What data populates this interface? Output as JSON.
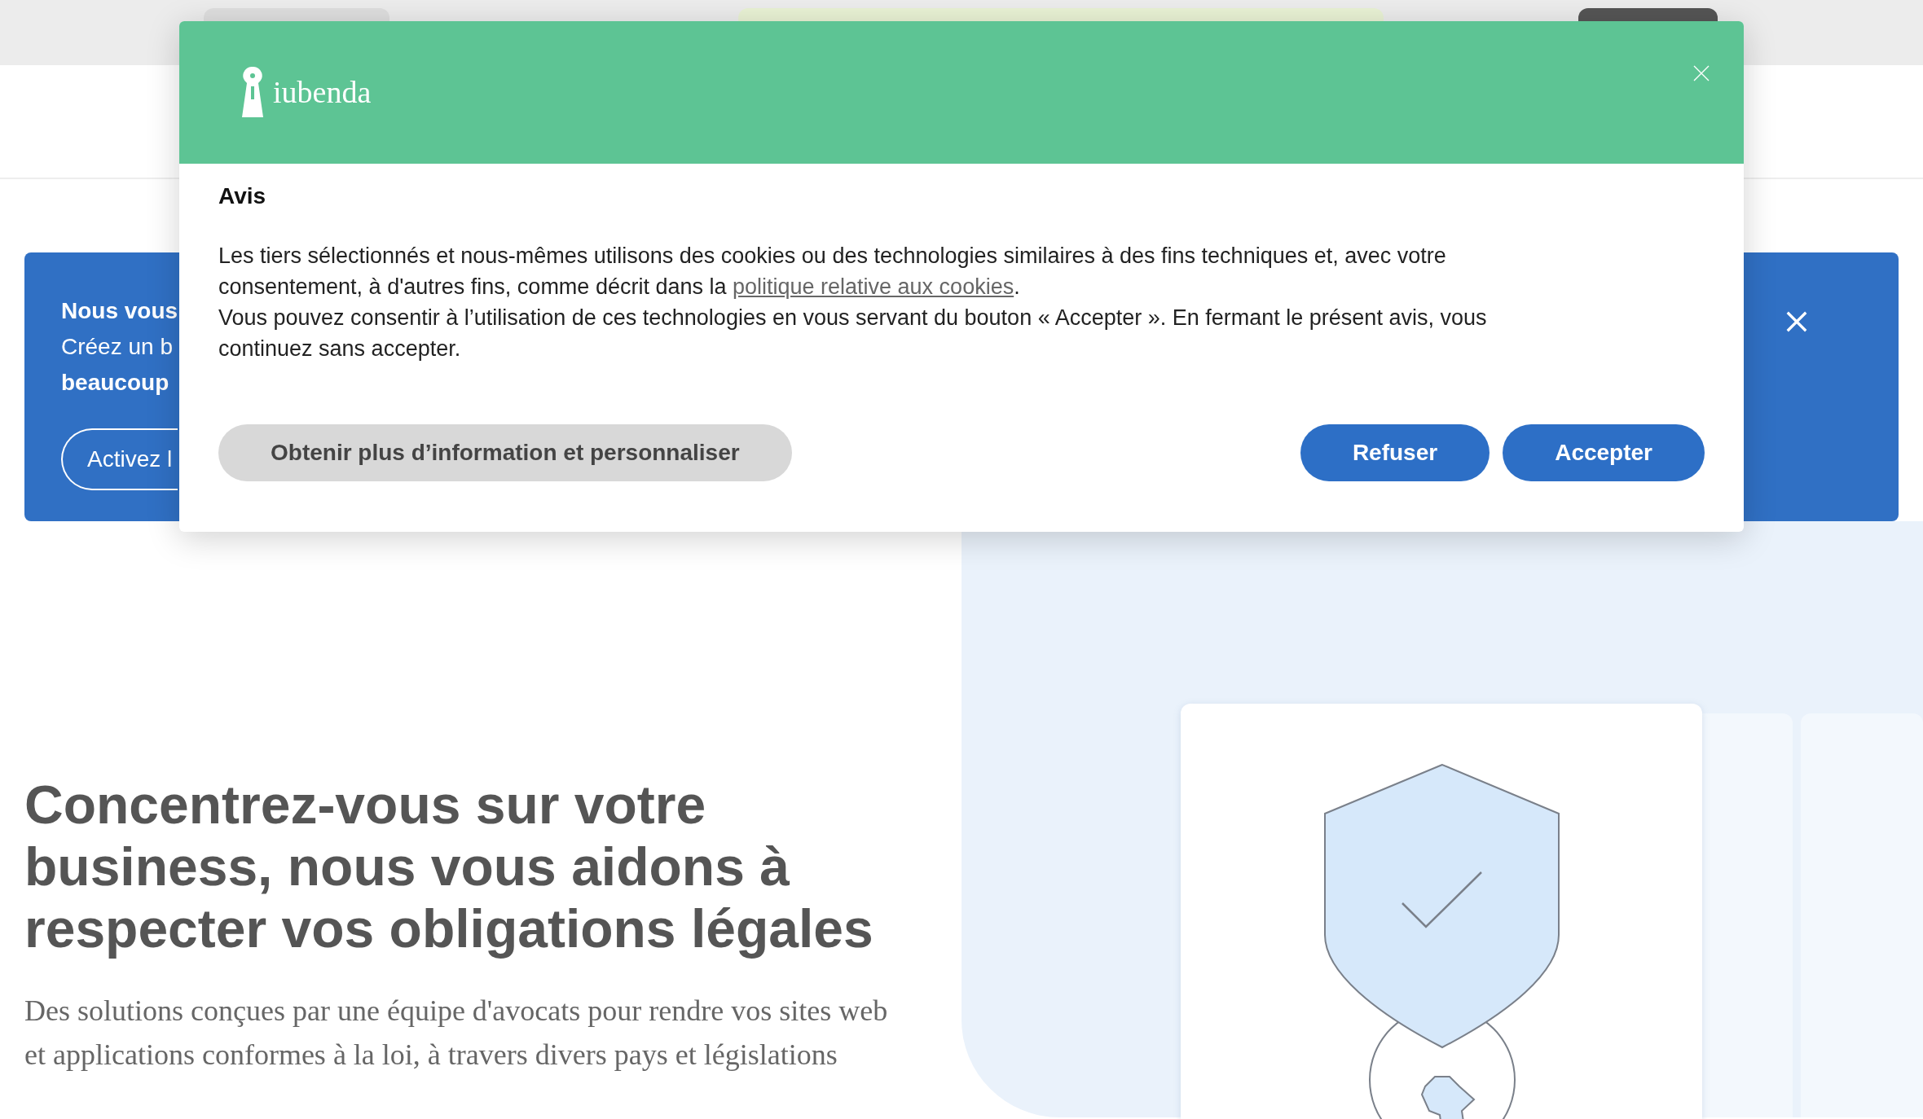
{
  "banner": {
    "title": "Nous vous",
    "line_2": "Créez un b",
    "line_3": "beaucoup",
    "button": "Activez l"
  },
  "dialog": {
    "logo_text": "iubenda",
    "heading": "Avis",
    "paragraph_1": {
      "before": "Les tiers sélectionnés et nous-mêmes utilisons des cookies ou des technologies similaires à des fins techniques et, avec votre consentement, à d'autres fins, comme décrit dans la ",
      "link": "politique relative aux cookies",
      "after": "."
    },
    "paragraph_2": "Vous pouvez consentir à l’utilisation de ces technologies en vous servant du bouton « Accepter ». En fermant le présent avis, vous continuez sans accepter.",
    "buttons": [
      {
        "label": "Obtenir plus d’information et personnaliser",
        "kind": "secondary"
      },
      {
        "label": "Refuser",
        "kind": "primary"
      },
      {
        "label": "Accepter",
        "kind": "primary"
      }
    ]
  },
  "hero": {
    "heading_lines": [
      "Concentrez-vous sur votre",
      "business, nous vous aidons à",
      "respecter vos obligations légales"
    ],
    "subtitle_lines": [
      "Des solutions conçues par une équipe d'avocats pour rendre vos sites web",
      "et applications conformes à la loi, à travers divers pays et législations"
    ]
  }
}
